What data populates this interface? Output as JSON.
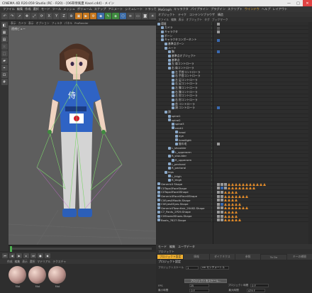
{
  "title": "CINEMA 4D R20.059 Studio (RC - R20) - [06帯侍風夏 Kaori.c4d] - メイン",
  "window_buttons": {
    "minimize": "—",
    "maximize": "□",
    "close": "✕"
  },
  "menubar": [
    "ファイル",
    "編集",
    "作成",
    "選択",
    "モード",
    "ツール",
    "メッシュ",
    "ボリューム",
    "スナップ",
    "アニメート",
    "シミュレート",
    "トラッカー",
    "レンダリング",
    "スカルプト",
    "モーショントラッカー"
  ],
  "menubar_highlight": "モーショントラッカー",
  "right_menubar": [
    "MoGraph",
    "キャラクタ",
    "パイプライン",
    "プラグイン",
    "スクリプト",
    "ウインドウ",
    "ヘルプ"
  ],
  "right_menubar_highlight": "ウインドウ",
  "layout_label": "レイアウト",
  "viewport_menu": [
    "表示",
    "カメラ",
    "表示",
    "オプション",
    "フィルタ",
    "パネル",
    "ProRender"
  ],
  "viewport_label": "透視ビュー",
  "object_manager": {
    "tabs": [
      "オブジェクト",
      "テイク",
      "コンテンツブラウザ",
      "構造"
    ],
    "menu": [
      "ファイル",
      "編集",
      "表示",
      "オブジェクト",
      "タグ",
      "ブックマーク"
    ],
    "rows": [
      {
        "name": "環境",
        "indent": 0,
        "tags": [
          "sq"
        ]
      },
      {
        "name": "カメラ",
        "indent": 1,
        "tags": [
          "dk"
        ]
      },
      {
        "name": "キャラクタ",
        "indent": 1,
        "tags": [
          "sq"
        ]
      },
      {
        "name": "ボーン",
        "indent": 1,
        "tags": []
      },
      {
        "name": "キャラクタコンポーネント",
        "indent": 1,
        "tags": [
          "bl"
        ]
      },
      {
        "name": "基準点ボーン",
        "indent": 2,
        "tags": []
      },
      {
        "name": "ルート",
        "indent": 2,
        "tags": []
      },
      {
        "name": "胸",
        "indent": 3,
        "tags": [
          "bl"
        ]
      },
      {
        "name": "基準点オブジェクト",
        "indent": 3,
        "tags": []
      },
      {
        "name": "基準点",
        "indent": 3,
        "tags": []
      },
      {
        "name": "左 肩コントローラ",
        "indent": 3,
        "tags": []
      },
      {
        "name": "右 肩コントローラ",
        "indent": 3,
        "tags": []
      },
      {
        "name": "左 手首コントローラ",
        "indent": 4,
        "tags": []
      },
      {
        "name": "右 手首コントローラ",
        "indent": 4,
        "tags": []
      },
      {
        "name": "左 足コントローラ",
        "indent": 4,
        "tags": []
      },
      {
        "name": "右 足コントローラ",
        "indent": 4,
        "tags": []
      },
      {
        "name": "左 膝コントローラ",
        "indent": 4,
        "tags": []
      },
      {
        "name": "右 膝コントローラ",
        "indent": 4,
        "tags": []
      },
      {
        "name": "左 肘コントローラ",
        "indent": 4,
        "tags": []
      },
      {
        "name": "右 肘コントローラ",
        "indent": 4,
        "tags": []
      },
      {
        "name": "首 コントローラ",
        "indent": 4,
        "tags": []
      },
      {
        "name": "頭 コントローラ",
        "indent": 4,
        "tags": [
          "bl"
        ]
      },
      {
        "name": "頭",
        "indent": 2,
        "tags": []
      },
      {
        "name": "spine1",
        "indent": 3,
        "tags": []
      },
      {
        "name": "spine2",
        "indent": 3,
        "tags": []
      },
      {
        "name": "spine3",
        "indent": 4,
        "tags": []
      },
      {
        "name": "neck1",
        "indent": 4,
        "tags": []
      },
      {
        "name": "head",
        "indent": 5,
        "tags": []
      },
      {
        "name": "eye",
        "indent": 5,
        "tags": []
      },
      {
        "name": "headlight",
        "indent": 5,
        "tags": []
      },
      {
        "name": "髪の毛",
        "indent": 5,
        "tags": [
          "sq"
        ]
      },
      {
        "name": "L_shoulder",
        "indent": 3,
        "tags": []
      },
      {
        "name": "L_upperarm",
        "indent": 4,
        "tags": []
      },
      {
        "name": "R_shoulder",
        "indent": 3,
        "tags": []
      },
      {
        "name": "R_upperarm",
        "indent": 4,
        "tags": []
      },
      {
        "name": "L_pectoral",
        "indent": 3,
        "tags": []
      },
      {
        "name": "R_pectoral",
        "indent": 3,
        "tags": []
      },
      {
        "name": "hips",
        "indent": 2,
        "tags": []
      },
      {
        "name": "L_thigh",
        "indent": 3,
        "tags": []
      },
      {
        "name": "R_thigh",
        "indent": 3,
        "tags": []
      },
      {
        "name": "Generic0 Shape",
        "indent": 0,
        "tags": [
          "sq",
          "sq",
          "sq",
          "tri",
          "tri",
          "tri",
          "tri",
          "tri",
          "tri",
          "tri",
          "tri",
          "tri",
          "tri",
          "tri"
        ]
      },
      {
        "name": "C0Tops0FaceShape",
        "indent": 0,
        "tags": [
          "sq",
          "bl",
          "sq",
          "tri",
          "tri",
          "tri",
          "tri",
          "tri",
          "tri",
          "tri",
          "tri"
        ]
      },
      {
        "name": "C0Tops0Face0Shape",
        "indent": 0,
        "tags": [
          "sq",
          "sq",
          "tri",
          "tri",
          "tri",
          "tri"
        ]
      },
      {
        "name": "Generic0Face0Face0Shape",
        "indent": 0,
        "tags": [
          "sq",
          "sq",
          "tri",
          "tri",
          "tri",
          "tri",
          "tri",
          "tri",
          "tri"
        ]
      },
      {
        "name": "C0Eyes0Mouth.Shape",
        "indent": 0,
        "tags": [
          "sq",
          "sq",
          "tri",
          "tri",
          "tri",
          "tri"
        ]
      },
      {
        "name": "C0Eyes0Eyes.Shape",
        "indent": 0,
        "tags": [
          "sq",
          "bl",
          "tri",
          "tri",
          "tri",
          "tri",
          "tri"
        ]
      },
      {
        "name": "Generic0TownHair_20482.Shape",
        "indent": 0,
        "tags": [
          "sq",
          "sq",
          "tri",
          "tri",
          "tri",
          "tri",
          "tri",
          "tri",
          "tri"
        ]
      },
      {
        "name": "C7_Pants_2P29.Shape",
        "indent": 0,
        "tags": [
          "sq",
          "sq",
          "tri",
          "tri",
          "tri",
          "tri"
        ]
      },
      {
        "name": "C0Shoes0Shoes.Shape",
        "indent": 0,
        "tags": [
          "sq",
          "sq",
          "tri",
          "tri",
          "tri",
          "tri"
        ]
      },
      {
        "name": "Boots_7827.Shape",
        "indent": 0,
        "tags": [
          "sq",
          "sq",
          "tri",
          "tri",
          "tri",
          "tri",
          "tri"
        ]
      }
    ]
  },
  "attribute_manager": {
    "tabs": [
      "モード",
      "編集",
      "ユーザデータ"
    ],
    "menu": [
      "プロジェクト"
    ],
    "subtabs": [
      "プロジェクト設定",
      "情報",
      "ダイナミクス",
      "参照",
      "To Do",
      "キーの補間"
    ],
    "active_subtab": "プロジェクト設定",
    "section_title": "プロジェクト設定",
    "row1": {
      "label": "プロジェクトスケール",
      "value": "1",
      "unit": "cm センチメートル"
    },
    "scale_button": "プロジェクトをスケール...",
    "fps_label": "FPS",
    "fps_value": "25",
    "time_label": "プロジェクト時間",
    "time_value": "0 F",
    "min_label": "最小時間",
    "min_value": "0 F",
    "max_label": "最大時間",
    "max_value": "479 F"
  },
  "materials": {
    "menu": [
      "作成",
      "編集",
      "表示",
      "選択",
      "マテリアル",
      "テクスチャ"
    ],
    "items": [
      {
        "label": "Mat"
      },
      {
        "label": "Mat"
      },
      {
        "label": "Mat"
      }
    ]
  }
}
